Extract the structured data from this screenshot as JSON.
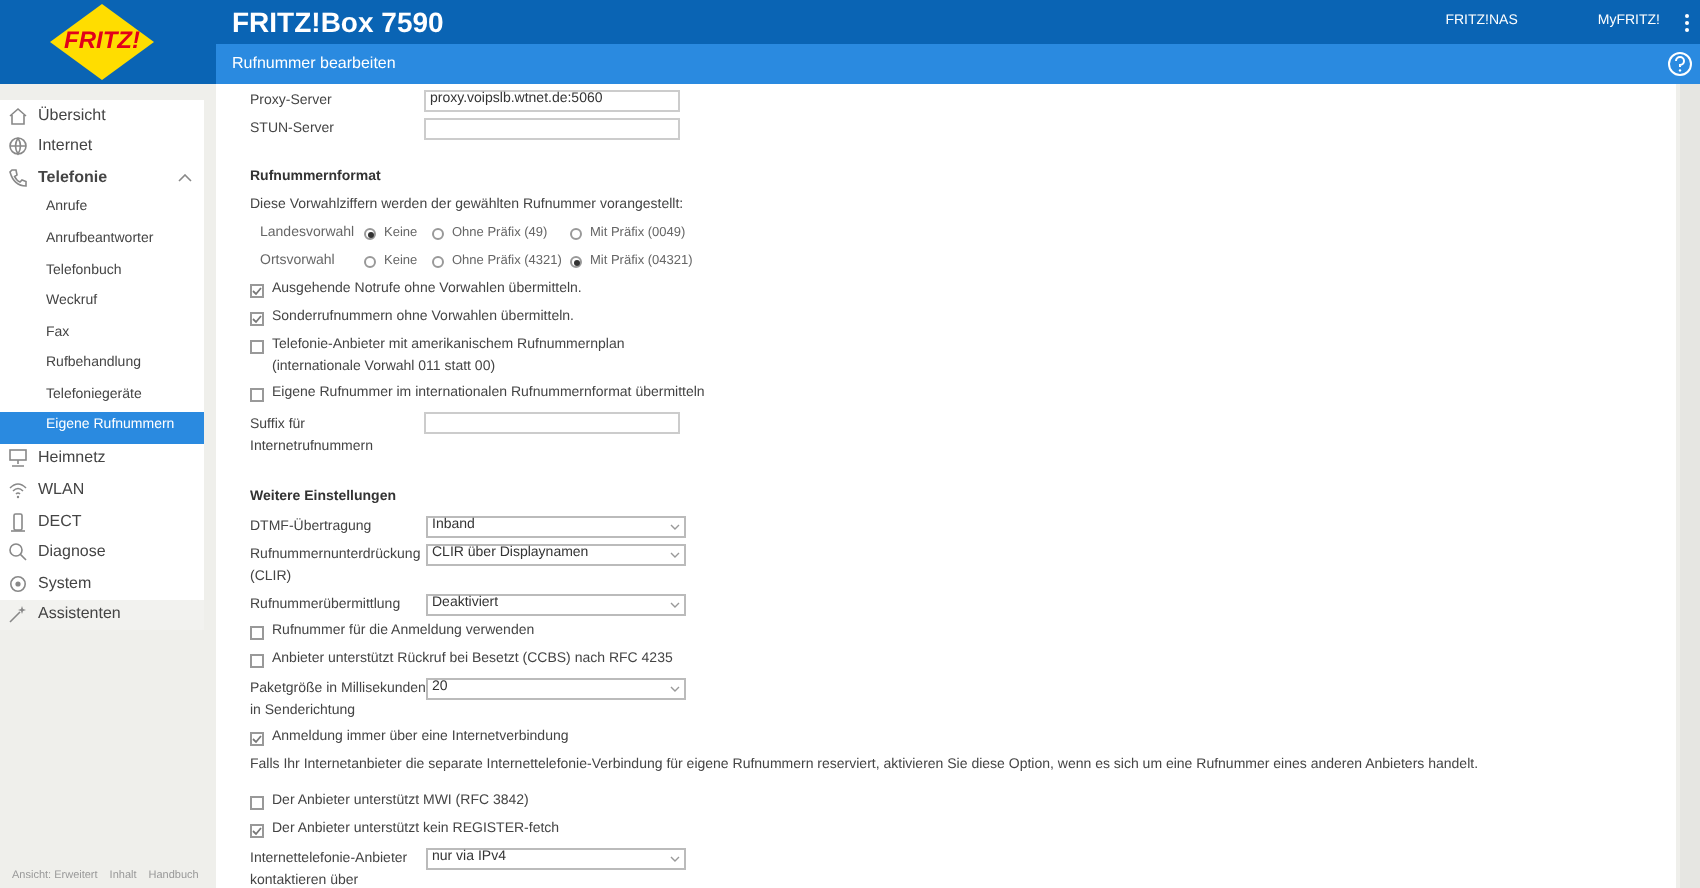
{
  "header": {
    "logo": "FRITZ!",
    "title": "FRITZ!Box 7590",
    "links": [
      "FRITZ!NAS",
      "MyFRITZ!"
    ],
    "page_title": "Rufnummer bearbeiten"
  },
  "sidebar": {
    "items": [
      {
        "label": "Übersicht",
        "selected": false
      },
      {
        "label": "Internet",
        "selected": false
      },
      {
        "label": "Telefonie",
        "selected": false,
        "expanded": true,
        "children": [
          {
            "label": "Anrufe",
            "selected": false
          },
          {
            "label": "Anrufbeantworter",
            "selected": false
          },
          {
            "label": "Telefonbuch",
            "selected": false
          },
          {
            "label": "Weckruf",
            "selected": false
          },
          {
            "label": "Fax",
            "selected": false
          },
          {
            "label": "Rufbehandlung",
            "selected": false
          },
          {
            "label": "Telefoniegeräte",
            "selected": false
          },
          {
            "label": "Eigene Rufnummern",
            "selected": true
          }
        ]
      },
      {
        "label": "Heimnetz",
        "selected": false
      },
      {
        "label": "WLAN",
        "selected": false
      },
      {
        "label": "DECT",
        "selected": false
      },
      {
        "label": "Diagnose",
        "selected": false
      },
      {
        "label": "System",
        "selected": false
      },
      {
        "label": "Assistenten",
        "selected": false
      }
    ],
    "footer_links": [
      "Ansicht: Erweitert",
      "Inhalt",
      "Handbuch"
    ]
  },
  "server_fields": [
    {
      "label": "Proxy-Server",
      "value": "proxy.voipslb.wtnet.de:5060"
    },
    {
      "label": "STUN-Server"
    }
  ],
  "number_format": {
    "heading": "Rufnummernformat",
    "description": "Diese Vorwahlziffern werden der gewählten Rufnummer vorangestellt:",
    "radio_groups": [
      {
        "label": "Landesvorwahl",
        "options": [
          {
            "label": "Keine",
            "selected": true
          },
          {
            "label": "Ohne Präfix (49)",
            "selected": false
          },
          {
            "label": "Mit Präfix (0049)",
            "selected": false
          }
        ]
      },
      {
        "label": "Ortsvorwahl",
        "options": [
          {
            "label": "Keine",
            "selected": false
          },
          {
            "label": "Ohne Präfix (4321)",
            "selected": false
          },
          {
            "label": "Mit Präfix (04321)",
            "selected": true
          }
        ]
      }
    ],
    "items": [
      {
        "kind": "checkbox",
        "label": "Ausgehende Notrufe ohne Vorwahlen übermitteln.",
        "checked": true
      },
      {
        "kind": "checkbox",
        "label": "Sonderrufnummern ohne Vorwahlen übermitteln.",
        "checked": true
      },
      {
        "kind": "checkbox",
        "label": "Telefonie-Anbieter mit amerikanischem Rufnummernplan",
        "note": "(internationale Vorwahl 011 statt 00)",
        "checked": false
      },
      {
        "kind": "checkbox",
        "label": "Eigene Rufnummer im internationalen Rufnummernformat übermitteln",
        "checked": false
      },
      {
        "kind": "field",
        "label": "Suffix für Internetrufnummern"
      }
    ]
  },
  "further_settings": {
    "heading": "Weitere Einstellungen",
    "items": [
      {
        "kind": "select",
        "label": "DTMF-Übertragung",
        "value": "Inband"
      },
      {
        "kind": "select",
        "label": "Rufnummernunterdrückung (CLIR)",
        "value": "CLIR über Displaynamen"
      },
      {
        "kind": "select",
        "label": "Rufnummerübermittlung",
        "value": "Deaktiviert"
      },
      {
        "kind": "checkbox",
        "label": "Rufnummer für die Anmeldung verwenden",
        "checked": false
      },
      {
        "kind": "checkbox",
        "label": "Anbieter unterstützt Rückruf bei Besetzt (CCBS) nach RFC 4235",
        "checked": false
      },
      {
        "kind": "select",
        "label": "Paketgröße in Millisekunden in Senderichtung",
        "value": "20"
      },
      {
        "kind": "checkbox",
        "label": "Anmeldung immer über eine Internetverbindung",
        "checked": true
      },
      {
        "kind": "note",
        "text": "Falls Ihr Internetanbieter die separate Internettelefonie-Verbindung für eigene Rufnummern reserviert, aktivieren Sie diese Option, wenn es sich um eine Rufnummer eines anderen Anbieters handelt."
      },
      {
        "kind": "checkbox",
        "label": "Der Anbieter unterstützt MWI (RFC 3842)",
        "checked": false
      },
      {
        "kind": "checkbox",
        "label": "Der Anbieter unterstützt kein REGISTER-fetch",
        "checked": true
      },
      {
        "kind": "select",
        "label": "Internettelefonie-Anbieter kontaktieren über",
        "value": "nur via IPv4"
      }
    ]
  }
}
